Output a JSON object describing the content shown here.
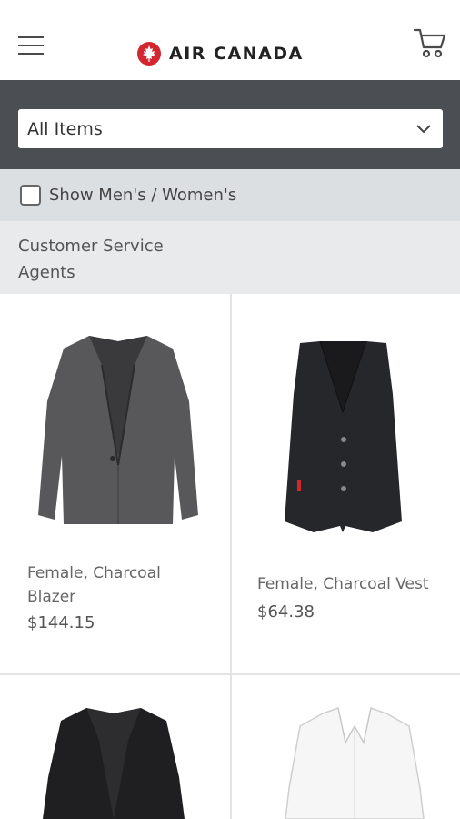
{
  "header": {
    "brand": "AIR CANADA",
    "menu_icon": "hamburger-menu-icon",
    "cart_icon": "shopping-cart-icon",
    "brand_color": "#d22630"
  },
  "filter": {
    "selected": "All Items",
    "dropdown_icon": "chevron-down-icon"
  },
  "toggle": {
    "label": "Show Men's / Women's",
    "checked": false
  },
  "category": {
    "title": "Customer Service Agents"
  },
  "products": [
    {
      "name": "Female, Charcoal Blazer",
      "price": "$144.15",
      "image": "charcoal-blazer-image"
    },
    {
      "name": "Female, Charcoal Vest",
      "price": "$64.38",
      "image": "charcoal-vest-image"
    },
    {
      "name": "",
      "price": "",
      "image": "black-jacket-image"
    },
    {
      "name": "",
      "price": "",
      "image": "white-blouse-image"
    }
  ],
  "colors": {
    "filter_band": "#4b4f54",
    "toggle_band": "#dcdfe1",
    "category_band": "#e9eaeb"
  }
}
